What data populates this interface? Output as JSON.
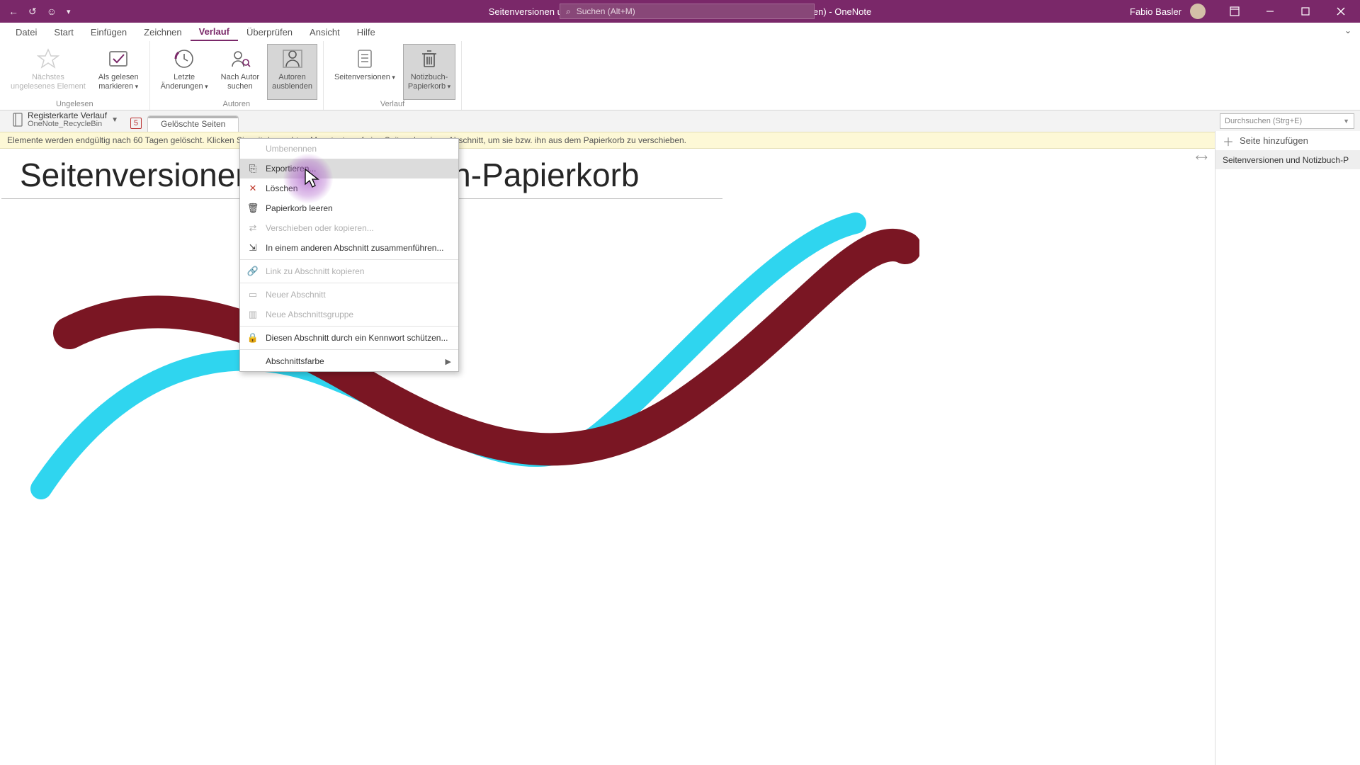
{
  "titlebar": {
    "title": "Seitenversionen und Notizbuch-Papierkorb (Schreibgeschützt - Gelöschte Notizen)  -  OneNote",
    "search_placeholder": "Suchen (Alt+M)",
    "user_name": "Fabio Basler"
  },
  "menu": {
    "tabs": [
      "Datei",
      "Start",
      "Einfügen",
      "Zeichnen",
      "Verlauf",
      "Überprüfen",
      "Ansicht",
      "Hilfe"
    ],
    "active_index": 4
  },
  "ribbon": {
    "groups": [
      {
        "label": "Ungelesen",
        "items": [
          {
            "label_line1": "Nächstes",
            "label_line2": "ungelesenes Element",
            "disabled": true,
            "icon": "star"
          },
          {
            "label_line1": "Als gelesen",
            "label_line2": "markieren",
            "dropdown": true,
            "icon": "check"
          }
        ]
      },
      {
        "label": "Autoren",
        "items": [
          {
            "label_line1": "Letzte",
            "label_line2": "Änderungen",
            "dropdown": true,
            "icon": "clock"
          },
          {
            "label_line1": "Nach Autor",
            "label_line2": "suchen",
            "icon": "person-search"
          },
          {
            "label_line1": "Autoren",
            "label_line2": "ausblenden",
            "pressed": true,
            "icon": "person-hide"
          }
        ]
      },
      {
        "label": "Verlauf",
        "items": [
          {
            "label_line1": "Seitenversionen",
            "label_line2": "",
            "dropdown": true,
            "icon": "page"
          },
          {
            "label_line1": "Notizbuch-",
            "label_line2": "Papierkorb",
            "dropdown": true,
            "pressed": true,
            "icon": "trash"
          }
        ]
      }
    ]
  },
  "section_row": {
    "notebook_title": "Registerkarte Verlauf",
    "notebook_sub": "OneNote_RecycleBin",
    "badge": "5",
    "tab_label": "Gelöschte Seiten",
    "search_placeholder": "Durchsuchen (Strg+E)"
  },
  "banner": {
    "text": "Elemente werden endgültig nach 60 Tagen gelöscht. Klicken Sie mit der rechten Maustaste auf eine Seite oder einen Abschnitt, um sie bzw. ihn aus dem Papierkorb zu verschieben."
  },
  "page": {
    "title": "Seitenversionen und Notizbuch-Papierkorb"
  },
  "rightpanel": {
    "add_page": "Seite hinzufügen",
    "page_item": "Seitenversionen und Notizbuch-P"
  },
  "context_menu": {
    "items": [
      {
        "label": "Umbenennen",
        "disabled": true
      },
      {
        "label": "Exportieren...",
        "icon": "export",
        "highlight": true
      },
      {
        "label": "Löschen",
        "icon": "delete-x"
      },
      {
        "label": "Papierkorb leeren",
        "icon": "trash"
      },
      {
        "label": "Verschieben oder kopieren...",
        "disabled": true,
        "icon": "move"
      },
      {
        "label": "In einem anderen Abschnitt zusammenführen...",
        "icon": "merge"
      },
      {
        "sep": true
      },
      {
        "label": "Link zu Abschnitt kopieren",
        "disabled": true,
        "icon": "link"
      },
      {
        "sep": true
      },
      {
        "label": "Neuer Abschnitt",
        "disabled": true,
        "icon": "section"
      },
      {
        "label": "Neue Abschnittsgruppe",
        "disabled": true,
        "icon": "group"
      },
      {
        "sep": true
      },
      {
        "label": "Diesen Abschnitt durch ein Kennwort schützen...",
        "icon": "lock"
      },
      {
        "sep": true
      },
      {
        "label": "Abschnittsfarbe",
        "submenu": true
      }
    ]
  },
  "colors": {
    "accent": "#7a2869"
  }
}
